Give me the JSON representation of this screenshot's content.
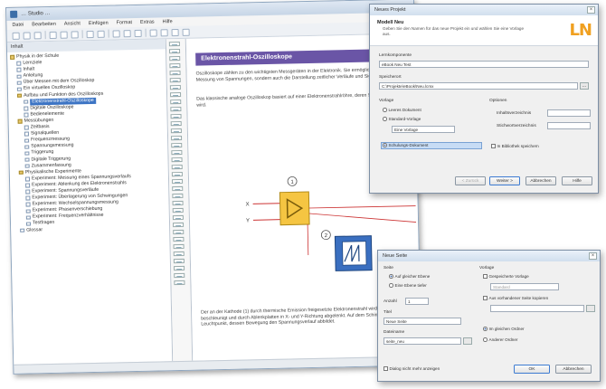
{
  "main_window": {
    "title": "… Studio …",
    "menu": [
      "Datei",
      "Bearbeiten",
      "Ansicht",
      "Einfügen",
      "Format",
      "Extras",
      "Hilfe"
    ],
    "left_pane_title": "Inhalt",
    "tree": [
      {
        "label": "Physik in der Schule",
        "type": "folder",
        "indent": 0
      },
      {
        "label": "Lernziele",
        "type": "page",
        "indent": 1
      },
      {
        "label": "Inhalt",
        "type": "page",
        "indent": 1
      },
      {
        "label": "Anleitung",
        "type": "page",
        "indent": 1
      },
      {
        "label": "Über Messen mit dem Oszilloskop",
        "type": "page",
        "indent": 1
      },
      {
        "label": "Ein virtuelles Oszilloskop",
        "type": "page",
        "indent": 1
      },
      {
        "label": "Aufbau und Funktion des Oszilloskops",
        "type": "folder",
        "indent": 1
      },
      {
        "label": "Elektronenstrahl-Oszilloskope",
        "type": "page",
        "indent": 2,
        "selected": true
      },
      {
        "label": "Digitale Oszilloskope",
        "type": "page",
        "indent": 2
      },
      {
        "label": "Bedienelemente",
        "type": "page",
        "indent": 2
      },
      {
        "label": "Messübungen",
        "type": "folder",
        "indent": 1
      },
      {
        "label": "Zeitbasis",
        "type": "page",
        "indent": 2
      },
      {
        "label": "Signalquellen",
        "type": "page",
        "indent": 2
      },
      {
        "label": "Frequenzmessung",
        "type": "page",
        "indent": 2
      },
      {
        "label": "Spannungsmessung",
        "type": "page",
        "indent": 2
      },
      {
        "label": "Triggerung",
        "type": "page",
        "indent": 2
      },
      {
        "label": "Digitale Triggerung",
        "type": "page",
        "indent": 2
      },
      {
        "label": "Zusammenfassung",
        "type": "page",
        "indent": 2
      },
      {
        "label": "Physikalische Experimente",
        "type": "folder",
        "indent": 1
      },
      {
        "label": "Experiment: Messung eines Spannungsverlaufs",
        "type": "page",
        "indent": 2
      },
      {
        "label": "Experiment: Ablenkung des Elektronenstrahls",
        "type": "page",
        "indent": 2
      },
      {
        "label": "Experiment: Spannungsverläufe",
        "type": "page",
        "indent": 2
      },
      {
        "label": "Experiment: Überlagerung von Schwingungen",
        "type": "page",
        "indent": 2
      },
      {
        "label": "Experiment: Wechselspannungsmessung",
        "type": "page",
        "indent": 2
      },
      {
        "label": "Experiment: Phasenverschiebung",
        "type": "page",
        "indent": 2
      },
      {
        "label": "Experiment: Frequenzverhältnisse",
        "type": "page",
        "indent": 2
      },
      {
        "label": "Testfragen",
        "type": "page",
        "indent": 2
      },
      {
        "label": "Glossar",
        "type": "page",
        "indent": 1
      }
    ],
    "heading": "Elektronenstrahl-Oszilloskope",
    "paragraphs": [
      "Oszilloskope zählen zu den wichtigsten Messgeräten in der Elektronik. Sie ermöglichen nicht nur die Messung von Spannungen, sondern auch die Darstellung zeitlicher Verläufe und Signalformen.",
      "Das klassische analoge Oszilloskop basiert auf einer Elektronenstrahlröhre, deren Strahl abgelenkt wird."
    ],
    "bottom_paragraph": "Der an der Kathode (1) durch thermische Emission freigesetzte Elektronenstrahl wird durch die Anode beschleunigt und durch Ablenkplatten in X- und Y-Richtung abgelenkt. Auf dem Schirm entsteht ein Leuchtpunkt, dessen Bewegung den Spannungsverlauf abbildet.",
    "diagram_labels": {
      "marker_a": "1",
      "marker_b": "2",
      "in_x": "X",
      "in_y": "Y"
    }
  },
  "dialog1": {
    "title": "Neues Projekt",
    "banner_title": "Modell Neu",
    "banner_sub": "Geben Sie den Namen für das neue Projekt ein und wählen Sie eine Vorlage aus.",
    "brand": "LN",
    "name_label": "Lernkomponente",
    "name_value": "eBook Neu Test",
    "path_label": "Speicherort",
    "path_value": "C:\\Projekte\\eBook\\Neu.lcmx",
    "browse": "...",
    "template_label": "Vorlage",
    "options_label": "Optionen",
    "radio_1": "Leeres Dokument",
    "radio_2": "Standard-Vorlage",
    "radio_3": "Eine Vorlage",
    "radio_4": "Schulungs-Dokument",
    "opt_1": "Inhaltsverzeichnis",
    "opt_2": "Stichwortverzeichnis",
    "opt_3": "In Bibliothek speichern",
    "btn_back": "< Zurück",
    "btn_next": "Weiter >",
    "btn_cancel": "Abbrechen",
    "btn_help": "Hilfe"
  },
  "dialog2": {
    "title": "Neue Seite",
    "page_label": "Seite",
    "radio_a": "Auf gleicher Ebene",
    "radio_b": "Eine Ebene tiefer",
    "template_label": "Vorlage",
    "chk_template": "Gespeicherte Vorlage",
    "template_value": "Standard",
    "chk_copy": "Aus vorhandener Seite kopieren",
    "count_label": "Anzahl",
    "count_value": "1",
    "title_label": "Titel",
    "title_value": "Neue Seite",
    "file_label": "Dateiname",
    "file_value": "seite_neu",
    "radio_ok": "Im gleichen Ordner",
    "radio_other": "Anderer Ordner",
    "chk_bottom": "Dialog nicht mehr anzeigen",
    "btn_ok": "OK",
    "btn_cancel": "Abbrechen"
  }
}
